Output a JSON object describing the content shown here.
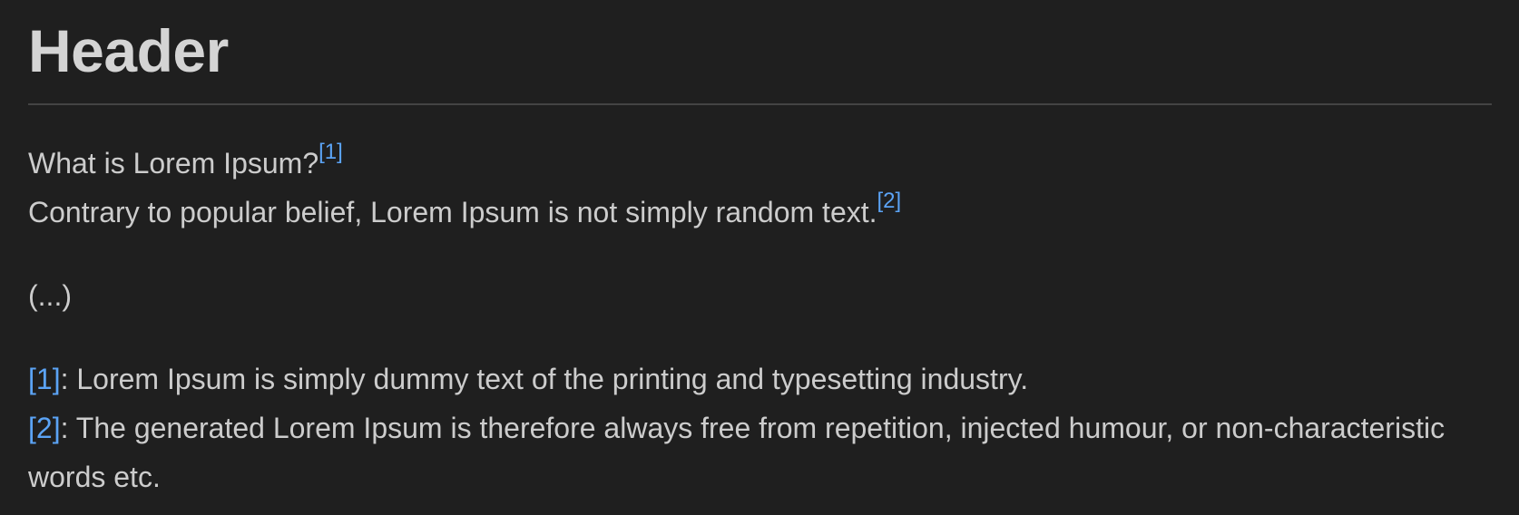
{
  "document": {
    "header": "Header",
    "lines": [
      {
        "text": "What is Lorem Ipsum?",
        "ref": "[1]"
      },
      {
        "text": "Contrary to popular belief, Lorem Ipsum is not simply random text.",
        "ref": "[2]"
      }
    ],
    "ellipsis": "(...)",
    "footnotes": [
      {
        "label": "[1]",
        "text": ": Lorem Ipsum is simply dummy text of the printing and typesetting industry."
      },
      {
        "label": "[2]",
        "text": ": The generated Lorem Ipsum is therefore always free from repetition, injected humour, or non-characteristic words etc."
      }
    ]
  },
  "colors": {
    "background": "#1f1f1f",
    "text": "#cccccc",
    "heading": "#d4d4d4",
    "link": "#5ba3f5",
    "rule": "#444444"
  }
}
